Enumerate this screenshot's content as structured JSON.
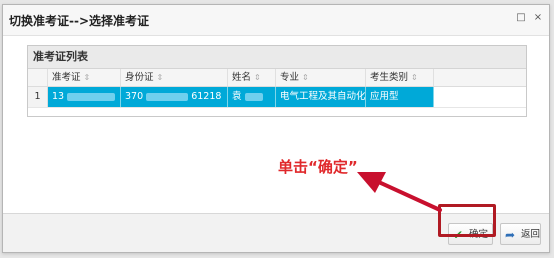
{
  "window": {
    "title": "切换准考证-->选择准考证",
    "maximize_glyph": "□",
    "close_glyph": "×"
  },
  "panel": {
    "title": "准考证列表",
    "columns": [
      "准考证",
      "身份证",
      "姓名",
      "专业",
      "考生类别"
    ],
    "rows": [
      {
        "index": "1",
        "ticket": "13",
        "id_start": "370",
        "id_end": "61218",
        "name": "袁",
        "major": "电气工程及其自动化",
        "category": "应用型"
      }
    ]
  },
  "annotation": {
    "text": "单击“确定”",
    "color": "#e0282b"
  },
  "buttons": {
    "ok_label": "确定",
    "back_label": "返回",
    "ok_icon": "check-icon",
    "back_icon": "return-arrow-icon"
  },
  "colors": {
    "selected_row": "#00a9d8",
    "highlight_box": "#b01a23",
    "arrow": "#c8102e"
  }
}
